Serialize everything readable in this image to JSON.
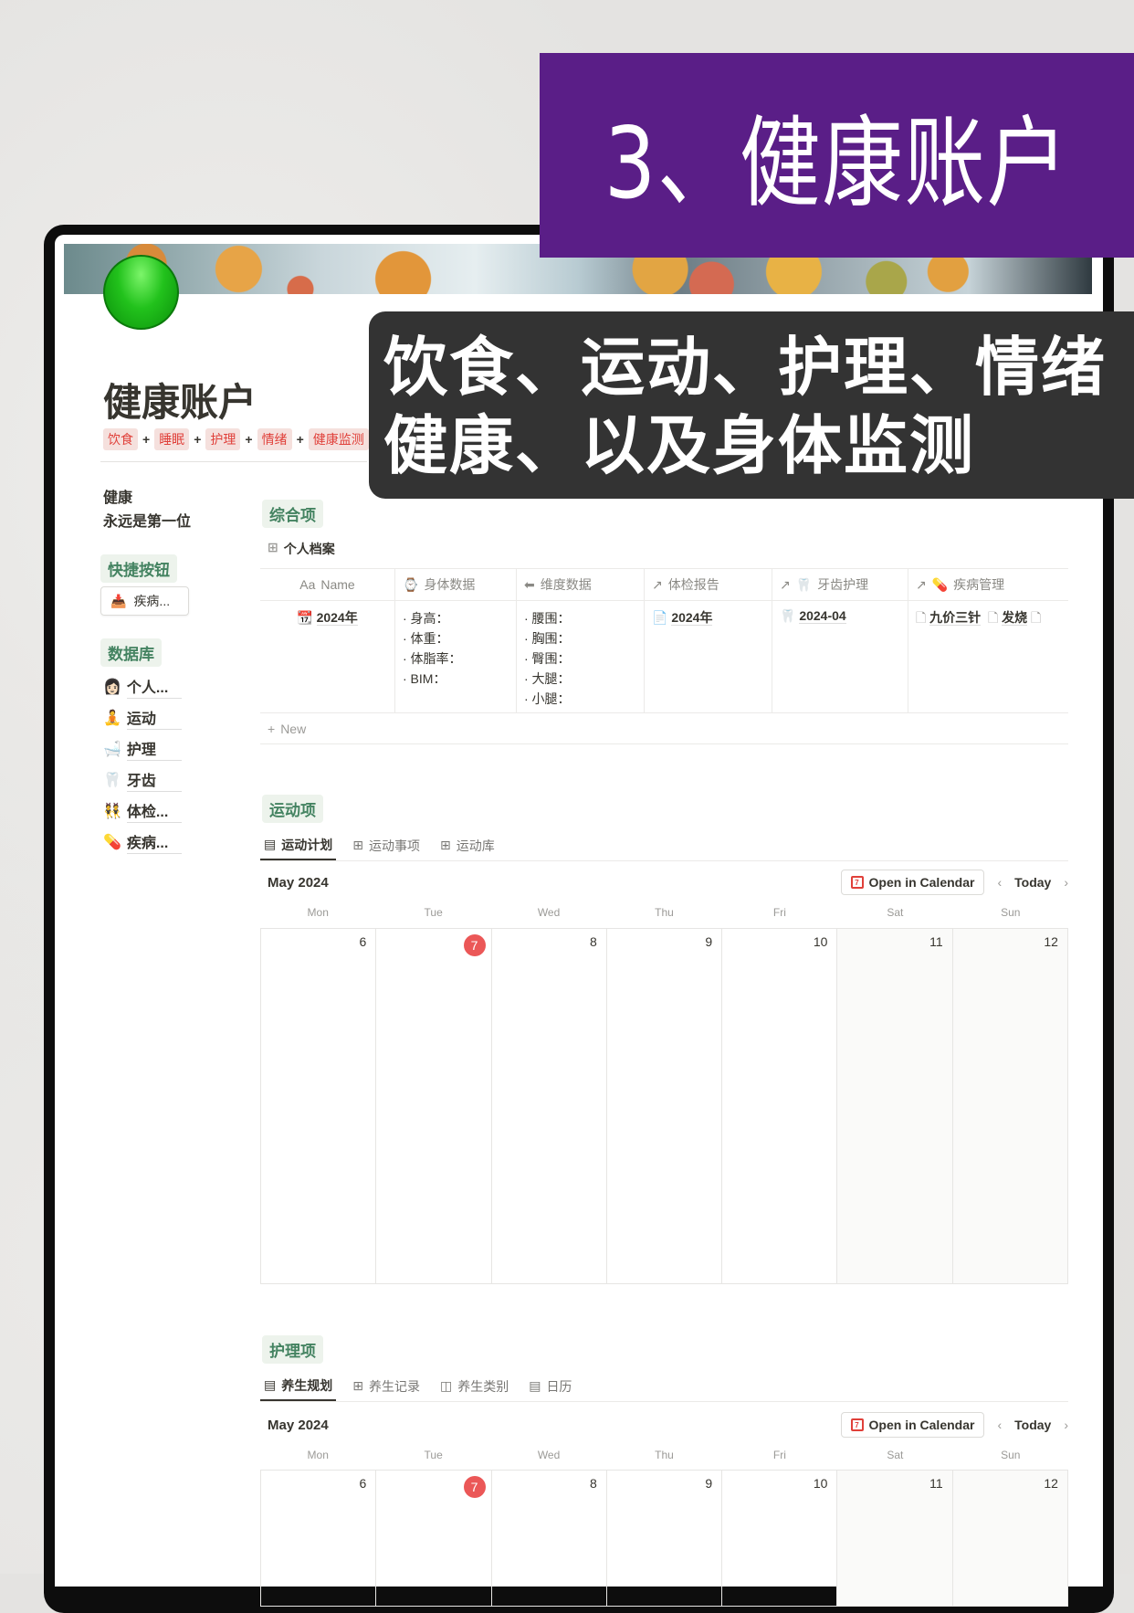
{
  "banner": {
    "title": "3、健康账户",
    "subtitle_line1": "饮食、运动、护理、情绪",
    "subtitle_line2": "健康、以及身体监测"
  },
  "colors": {
    "banner_bg": "#5a1e87",
    "overlay_bg": "#333333",
    "tag_red": "#e0403a",
    "tag_green": "#448361",
    "today": "#eb5757"
  },
  "page": {
    "title": "健康账户",
    "tags": [
      "饮食",
      "睡眠",
      "护理",
      "情绪",
      "健康监测"
    ],
    "plus": "+",
    "motto_line1": "健康",
    "motto_line2": "永远是第一位"
  },
  "sidebar": {
    "quick_label": "快捷按钮",
    "quick_button": {
      "icon": "inbox-tray-icon",
      "label": "疾病..."
    },
    "db_label": "数据库",
    "db_items": [
      {
        "icon": "👩🏻",
        "label": "个人..."
      },
      {
        "icon": "🧘",
        "label": "运动"
      },
      {
        "icon": "🛁",
        "label": "护理"
      },
      {
        "icon": "🦷",
        "label": "牙齿"
      },
      {
        "icon": "👯",
        "label": "体检..."
      },
      {
        "icon": "💊",
        "label": "疾病..."
      }
    ]
  },
  "overview": {
    "section_label": "综合项",
    "view_label": "个人档案",
    "columns": [
      "Name",
      "身体数据",
      "维度数据",
      "体检报告",
      "牙齿护理",
      "疾病管理"
    ],
    "name_prefix": "Aa",
    "row": {
      "name": "2024年",
      "body": [
        "· 身高：",
        "· 体重：",
        "· 体脂率：",
        "· BIM："
      ],
      "dims": [
        "· 腰围：",
        "· 胸围：",
        "· 臀围：",
        "· 大腿：",
        "· 小腿："
      ],
      "report": "2024年",
      "teeth": "2024-04",
      "disease": [
        "九价三针",
        "发烧"
      ]
    },
    "new_label": "New"
  },
  "exercise": {
    "section_label": "运动项",
    "tabs": [
      "运动计划",
      "运动事项",
      "运动库"
    ],
    "month": "May 2024",
    "open_calendar": "Open in Calendar",
    "today": "Today",
    "weekdays": [
      "Mon",
      "Tue",
      "Wed",
      "Thu",
      "Fri",
      "Sat",
      "Sun"
    ],
    "dates": [
      "6",
      "7",
      "8",
      "9",
      "10",
      "11",
      "12"
    ],
    "today_date": "7"
  },
  "care": {
    "section_label": "护理项",
    "tabs": [
      "养生规划",
      "养生记录",
      "养生类别",
      "日历"
    ],
    "month": "May 2024",
    "open_calendar": "Open in Calendar",
    "today": "Today",
    "weekdays": [
      "Mon",
      "Tue",
      "Wed",
      "Thu",
      "Fri",
      "Sat",
      "Sun"
    ],
    "dates": [
      "6",
      "7",
      "8",
      "9",
      "10",
      "11",
      "12"
    ],
    "today_date": "7"
  }
}
